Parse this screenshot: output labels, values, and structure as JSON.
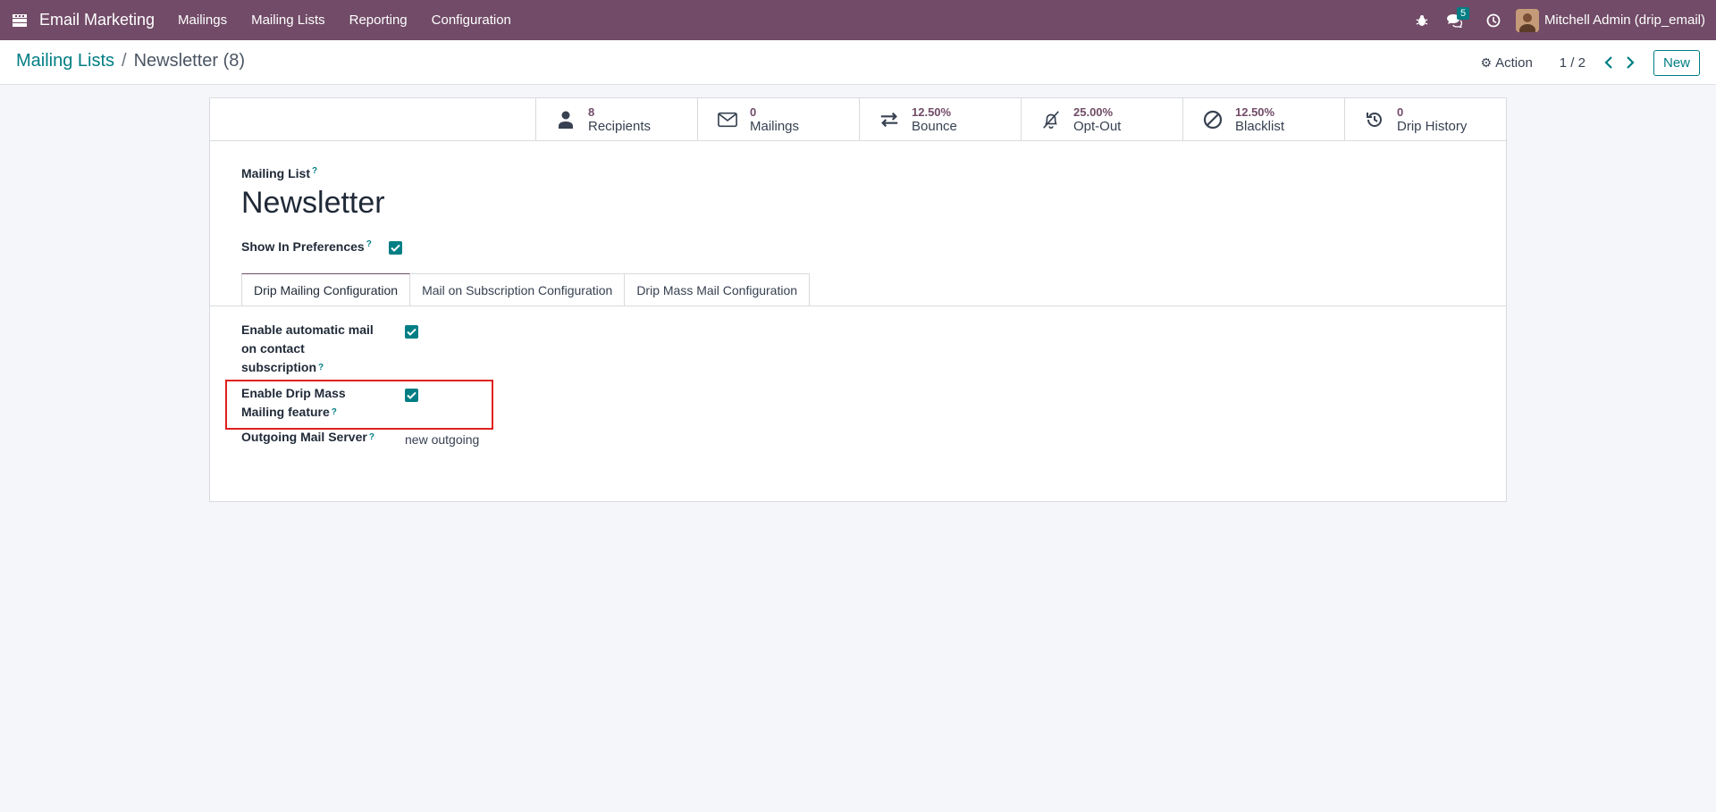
{
  "navbar": {
    "app_title": "Email Marketing",
    "menu": [
      "Mailings",
      "Mailing Lists",
      "Reporting",
      "Configuration"
    ],
    "messages_count": "5",
    "user_name": "Mitchell Admin (drip_email)"
  },
  "control_panel": {
    "breadcrumb_parent": "Mailing Lists",
    "breadcrumb_current": "Newsletter (8)",
    "action_label": "Action",
    "pager": "1 / 2",
    "new_label": "New"
  },
  "stat_buttons": [
    {
      "value": "8",
      "label": "Recipients",
      "icon": "user-icon"
    },
    {
      "value": "0",
      "label": "Mailings",
      "icon": "envelope-icon"
    },
    {
      "value": "12.50%",
      "label": "Bounce",
      "icon": "exchange-icon"
    },
    {
      "value": "25.00%",
      "label": "Opt-Out",
      "icon": "bell-slash-icon"
    },
    {
      "value": "12.50%",
      "label": "Blacklist",
      "icon": "ban-icon"
    },
    {
      "value": "0",
      "label": "Drip History",
      "icon": "history-icon"
    }
  ],
  "form": {
    "name_caption": "Mailing List",
    "name": "Newsletter",
    "show_in_preferences_label": "Show In Preferences",
    "show_in_preferences": true,
    "tabs": [
      "Drip Mailing Configuration",
      "Mail on Subscription Configuration",
      "Drip Mass Mail Configuration"
    ],
    "active_tab": 0,
    "fields": {
      "auto_mail_label": "Enable automatic mail on contact subscription",
      "auto_mail": true,
      "drip_mass_label": "Enable Drip Mass Mailing feature",
      "drip_mass": true,
      "mail_server_label": "Outgoing Mail Server",
      "mail_server_value": "new outgoing"
    }
  },
  "colors": {
    "navbar": "#714b67",
    "accent": "#017e84",
    "highlight": "#e02020"
  }
}
